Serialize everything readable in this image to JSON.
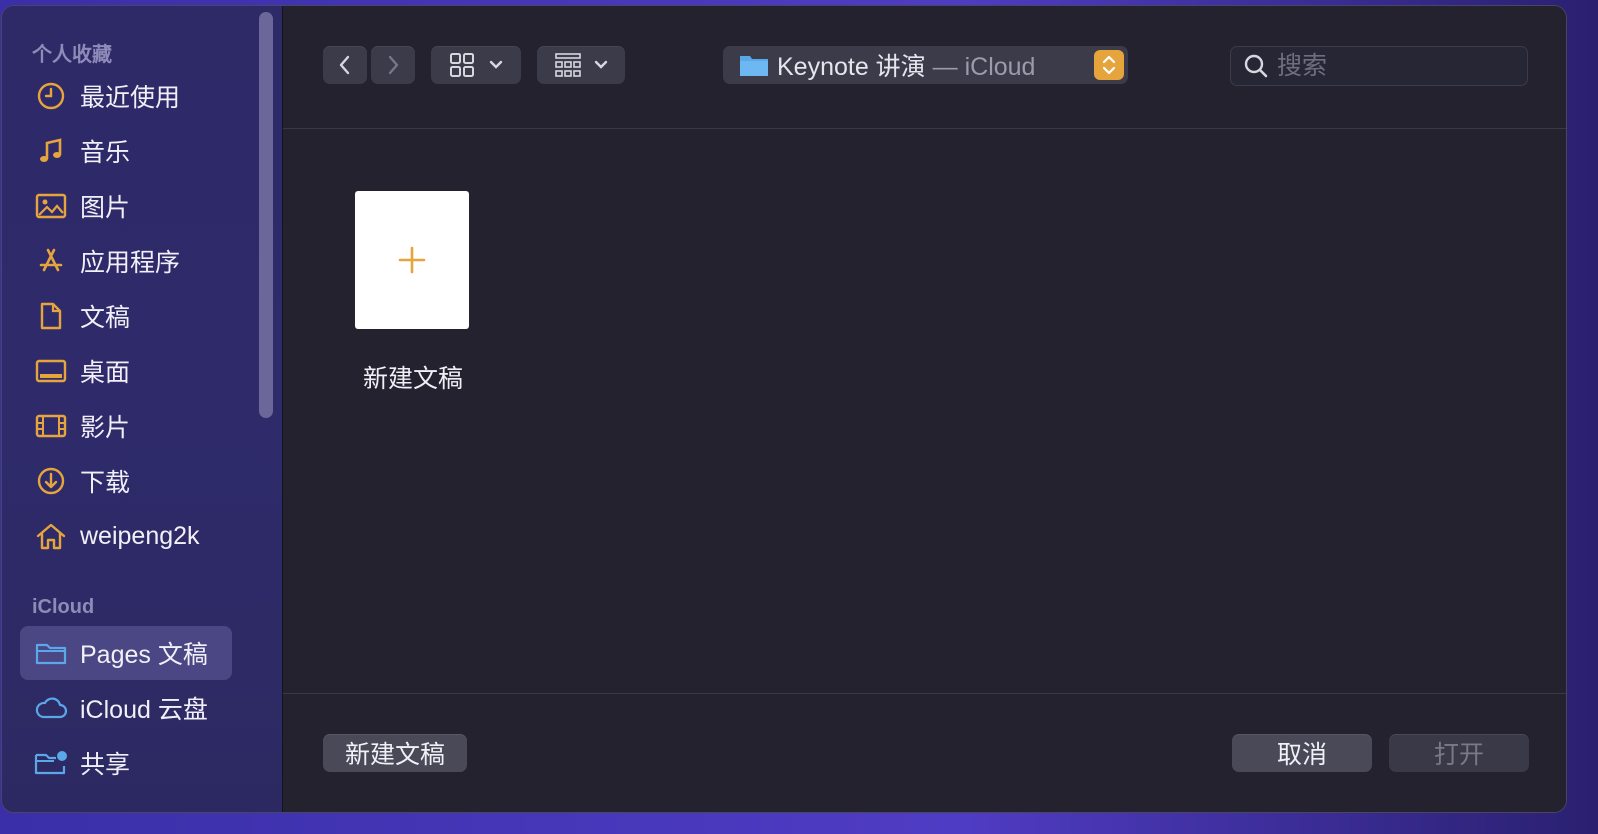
{
  "sidebar": {
    "favorites_title": "个人收藏",
    "favorites": [
      {
        "label": "最近使用",
        "icon": "clock-icon"
      },
      {
        "label": "音乐",
        "icon": "music-note-icon"
      },
      {
        "label": "图片",
        "icon": "photo-icon"
      },
      {
        "label": "应用程序",
        "icon": "app-store-icon"
      },
      {
        "label": "文稿",
        "icon": "document-icon"
      },
      {
        "label": "桌面",
        "icon": "desktop-icon"
      },
      {
        "label": "影片",
        "icon": "film-icon"
      },
      {
        "label": "下载",
        "icon": "download-icon"
      },
      {
        "label": "weipeng2k",
        "icon": "home-icon"
      }
    ],
    "icloud_title": "iCloud",
    "icloud": [
      {
        "label": "Pages 文稿",
        "icon": "folder-icon",
        "selected": true
      },
      {
        "label": "iCloud 云盘",
        "icon": "cloud-icon"
      },
      {
        "label": "共享",
        "icon": "shared-folder-icon"
      }
    ]
  },
  "toolbar": {
    "location_main": "Keynote 讲演",
    "location_sep": " — iCloud",
    "search_placeholder": "搜索"
  },
  "content": {
    "new_doc_tile_label": "新建文稿"
  },
  "footer": {
    "new_doc_button": "新建文稿",
    "cancel_button": "取消",
    "open_button": "打开"
  },
  "colors": {
    "accent": "#e5a43c",
    "folder_blue": "#5aa8e8"
  }
}
